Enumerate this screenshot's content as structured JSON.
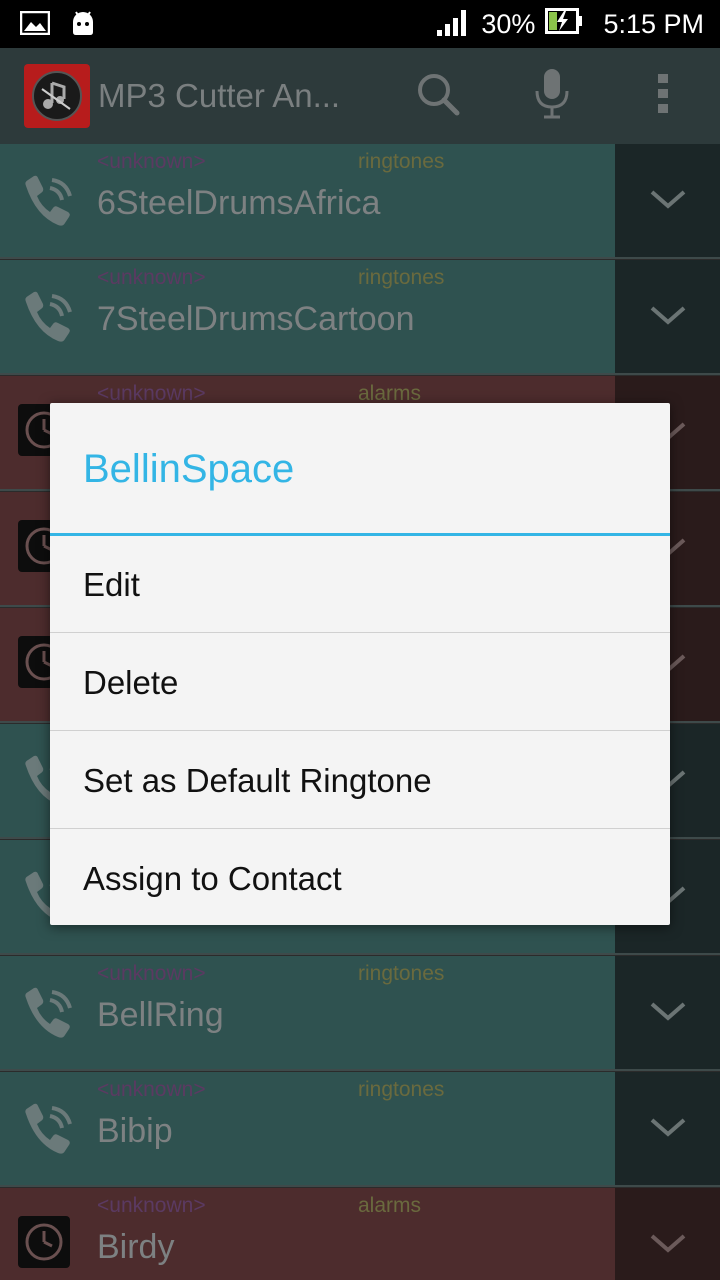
{
  "status_bar": {
    "battery": "30%",
    "time": "5:15 PM"
  },
  "app_bar": {
    "title": "MP3 Cutter An...",
    "icons": [
      "search-icon",
      "microphone-icon",
      "overflow-menu-icon"
    ]
  },
  "list": {
    "rows": [
      {
        "artist": "<unknown>",
        "category": "ringtones",
        "name": "6SteelDrumsAfrica",
        "type": "ringtone"
      },
      {
        "artist": "<unknown>",
        "category": "ringtones",
        "name": "7SteelDrumsCartoon",
        "type": "ringtone"
      },
      {
        "artist": "<unknown>",
        "category": "alarms",
        "name": "",
        "type": "alarm"
      },
      {
        "artist": "",
        "category": "",
        "name": "",
        "type": "alarm"
      },
      {
        "artist": "",
        "category": "",
        "name": "",
        "type": "alarm"
      },
      {
        "artist": "",
        "category": "",
        "name": "",
        "type": "ringtone"
      },
      {
        "artist": "",
        "category": "",
        "name": "",
        "type": "ringtone"
      },
      {
        "artist": "<unknown>",
        "category": "ringtones",
        "name": "BellRing",
        "type": "ringtone"
      },
      {
        "artist": "<unknown>",
        "category": "ringtones",
        "name": "Bibip",
        "type": "ringtone"
      },
      {
        "artist": "<unknown>",
        "category": "alarms",
        "name": "Birdy",
        "type": "alarm"
      }
    ]
  },
  "dialog": {
    "title": "BellinSpace",
    "items": [
      "Edit",
      "Delete",
      "Set as Default Ringtone",
      "Assign to Contact"
    ]
  },
  "colors": {
    "accent": "#33b5e5",
    "ringtone_row": "#2f5250",
    "alarm_row": "#4d2c2d"
  }
}
